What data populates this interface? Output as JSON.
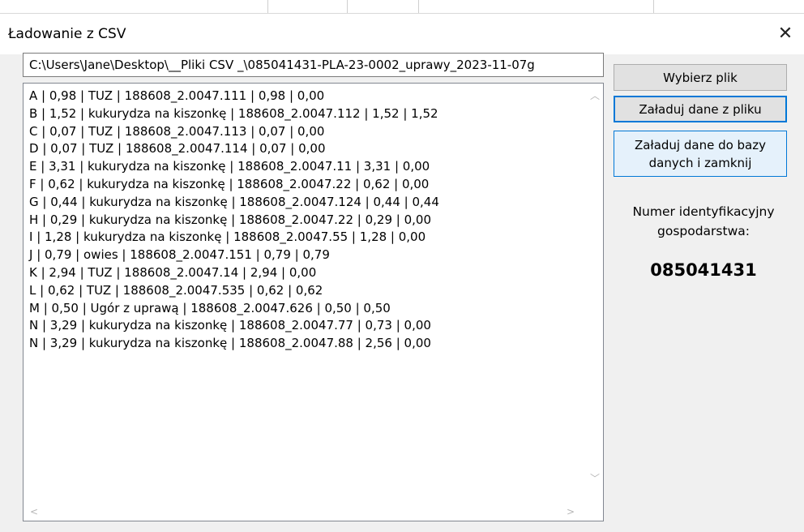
{
  "window": {
    "title": "Ładowanie z CSV",
    "close_glyph": "✕"
  },
  "file": {
    "path": "C:\\Users\\Jane\\Desktop\\__Pliki CSV _\\085041431-PLA-23-0002_uprawy_2023-11-07g"
  },
  "rows": [
    "A | 0,98 | TUZ | 188608_2.0047.111 | 0,98 | 0,00",
    "B | 1,52 | kukurydza na kiszonkę | 188608_2.0047.112 | 1,52 | 1,52",
    "C | 0,07 | TUZ | 188608_2.0047.113 | 0,07 | 0,00",
    "D | 0,07 | TUZ | 188608_2.0047.114 | 0,07 | 0,00",
    "E | 3,31 | kukurydza na kiszonkę | 188608_2.0047.11 | 3,31 | 0,00",
    "F | 0,62 | kukurydza na kiszonkę | 188608_2.0047.22 | 0,62 | 0,00",
    "G | 0,44 | kukurydza na kiszonkę | 188608_2.0047.124 | 0,44 | 0,44",
    "H | 0,29 | kukurydza na kiszonkę | 188608_2.0047.22 | 0,29 | 0,00",
    "I | 1,28 | kukurydza na kiszonkę | 188608_2.0047.55 | 1,28 | 0,00",
    "J | 0,79 | owies | 188608_2.0047.151 | 0,79 | 0,79",
    "K | 2,94 | TUZ | 188608_2.0047.14 | 2,94 | 0,00",
    "L | 0,62 | TUZ | 188608_2.0047.535 | 0,62 | 0,62",
    "M | 0,50 | Ugór z uprawą | 188608_2.0047.626 | 0,50 | 0,50",
    "N | 3,29 | kukurydza na kiszonkę | 188608_2.0047.77 | 0,73 | 0,00",
    "N | 3,29 | kukurydza na kiszonkę | 188608_2.0047.88 | 2,56 | 0,00"
  ],
  "buttons": {
    "choose_file": "Wybierz plik",
    "load_from_file": "Załaduj dane z pliku",
    "load_to_db_line1": "Załaduj dane do bazy",
    "load_to_db_line2": "danych i zamknij"
  },
  "farm": {
    "label_line1": "Numer identyfikacyjny",
    "label_line2": "gospodarstwa:",
    "id": "085041431"
  },
  "scroll_glyphs": {
    "up": "︿",
    "down": "﹀",
    "left": "<",
    "right": ">"
  },
  "colors": {
    "accent": "#0078d7",
    "dialog_bg": "#f0f0f0",
    "button_bg": "#e1e1e1"
  }
}
